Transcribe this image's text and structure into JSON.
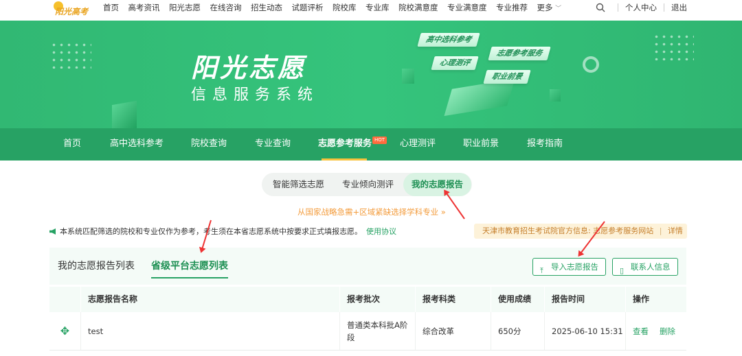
{
  "header": {
    "logo_text": "阳光高考",
    "nav": [
      "首页",
      "高考资讯",
      "阳光志愿",
      "在线咨询",
      "招生动态",
      "试题评析",
      "院校库",
      "专业库",
      "院校满意度",
      "专业满意度",
      "专业推荐",
      "更多"
    ],
    "personal_center": "个人中心",
    "logout": "退出"
  },
  "banner": {
    "title": "阳光志愿",
    "subtitle": "信息服务系统",
    "tags": [
      "高中选科参考",
      "心理测评",
      "志愿参考服务",
      "职业前景"
    ]
  },
  "main_nav": {
    "items": [
      "首页",
      "高中选科参考",
      "院校查询",
      "专业查询",
      "志愿参考服务",
      "心理测评",
      "职业前景",
      "报考指南"
    ],
    "active": "志愿参考服务",
    "hot_badge": "HOT"
  },
  "sub_tabs": {
    "items": [
      "智能筛选志愿",
      "专业倾向测评",
      "我的志愿报告"
    ],
    "active": "我的志愿报告"
  },
  "slogan": "从国家战略急需+区域紧缺选择学科专业 »",
  "notice": {
    "text": "本系统匹配筛选的院校和专业仅作为参考，考生须在本省志愿系统中按要求正式填报志愿。",
    "link": "使用协议"
  },
  "tianjin": {
    "text": "天津市教育招生考试院官方信息: 志愿参考服务网站",
    "detail": "详情"
  },
  "list_tabs": {
    "my_reports": "我的志愿报告列表",
    "provincial": "省级平台志愿列表"
  },
  "buttons": {
    "import": "导入志愿报告",
    "contact": "联系人信息"
  },
  "table": {
    "columns": [
      "",
      "志愿报告名称",
      "报考批次",
      "报考科类",
      "使用成绩",
      "报告时间",
      "操作"
    ],
    "rows": [
      {
        "name": "test",
        "batch": "普通类本科批A阶段",
        "category": "综合改革",
        "score": "650分",
        "time": "2025-06-10 15:31",
        "view": "查看",
        "delete": "删除"
      }
    ]
  },
  "colors": {
    "primary_green": "#27a264",
    "banner_green": "#35c47c",
    "accent_orange": "#f39c3d",
    "annotation_red": "#e33"
  }
}
